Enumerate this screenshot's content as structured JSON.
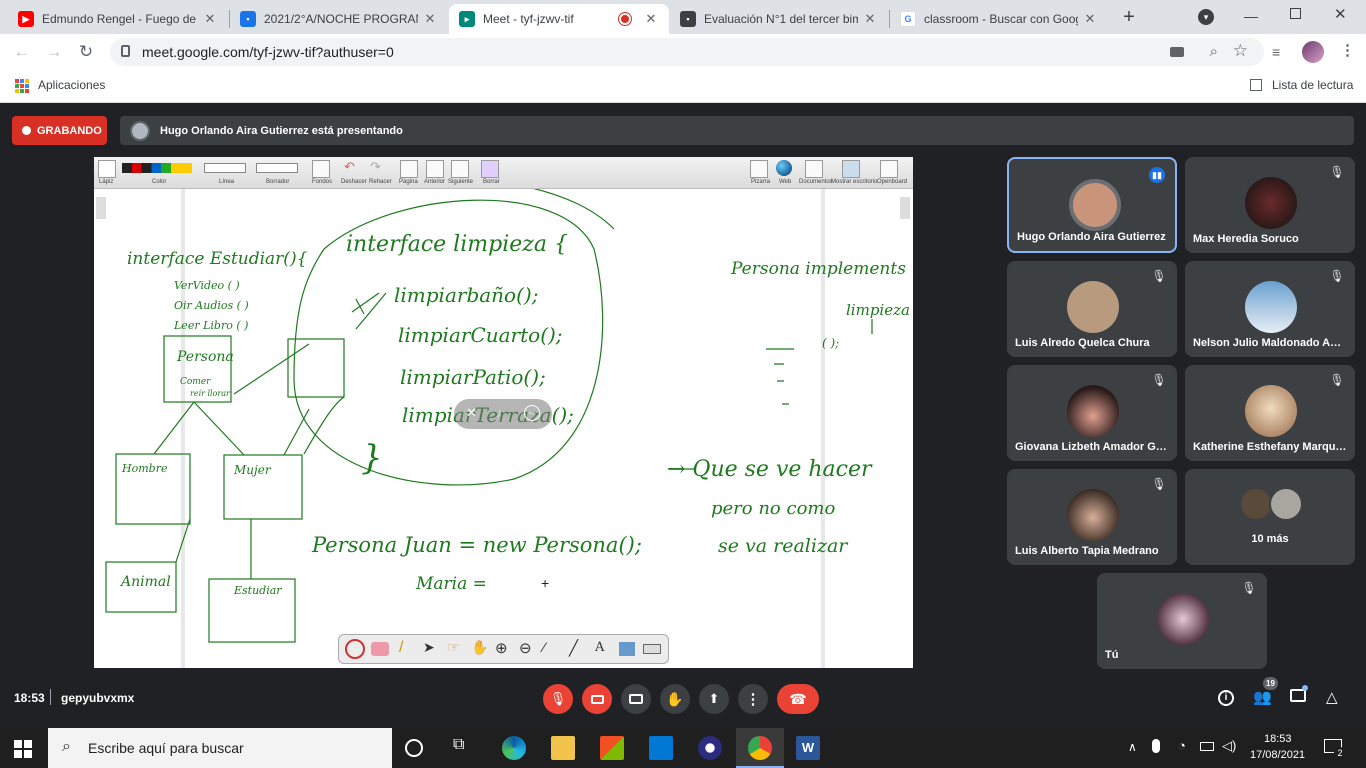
{
  "browser": {
    "tabs": [
      {
        "title": "Edmundo Rengel - Fuego de",
        "icon": "youtube-icon"
      },
      {
        "title": "2021/2°A/NOCHE PROGRAM",
        "icon": "classroom-icon"
      },
      {
        "title": "Meet - tyf-jzwv-tif",
        "icon": "meet-icon",
        "active": true
      },
      {
        "title": "Evaluación N°1 del tercer bim",
        "icon": "classroom-icon"
      },
      {
        "title": "classroom - Buscar con Goog",
        "icon": "google-icon"
      }
    ],
    "url": "meet.google.com/tyf-jzwv-tif?authuser=0",
    "apps_label": "Aplicaciones",
    "reading_list_label": "Lista de lectura"
  },
  "meet": {
    "recording_label": "GRABANDO",
    "presenting_text": "Hugo Orlando Aira Gutierrez está presentando",
    "whiteboard": {
      "toolbar_labels": [
        "Lápiz",
        "Color",
        "Línea",
        "Borrador",
        "Fondos",
        "Deshacer",
        "Rehacer",
        "Página",
        "Anterior",
        "Siguiente",
        "Borrar",
        "Pizarra",
        "Web",
        "Documentos",
        "Mostrar escritorio",
        "Openboard"
      ],
      "text": {
        "interface_estudiar": "interface Estudiar(){",
        "ver_video": "VerVideo ( )",
        "oir_audio": "Oir Audios ( )",
        "leer_libro": "Leer Libro ( )",
        "persona_box": "Persona",
        "persona_sub1": "Comer",
        "persona_sub2": "reír  llorar",
        "hombre": "Hombre",
        "mujer": "Mujer",
        "animal": "Animal",
        "estudiar": "Estudiar",
        "interface_limpieza": "interface limpieza {",
        "m1": "limpiarbaño();",
        "m2": "limpiarCuarto();",
        "m3": "limpiarPatio();",
        "m4": "limpiarTerraza();",
        "close_brace": "}",
        "persona_impl": "Persona implements",
        "limpieza": "limpieza",
        "semis": "( );",
        "que_se": "→ Que se ve hacer",
        "pero": "pero no como",
        "se_va": "se va realizar",
        "persona_juan": "Persona Juan = new Persona();",
        "maria": "Maria ="
      }
    },
    "participants": [
      {
        "name": "Hugo Orlando Aira Gutierrez",
        "speaking": true,
        "face": "#c9957a"
      },
      {
        "name": "Max Heredia Soruco",
        "muted": true,
        "face": "#2a1a1a"
      },
      {
        "name": "Luis Alredo Quelca Chura",
        "muted": true,
        "face": "#b89a7e"
      },
      {
        "name": "Nelson Julio Maldonado Am...",
        "muted": true,
        "face": "#8fb4d6"
      },
      {
        "name": "Giovana Lizbeth Amador Ga...",
        "muted": true,
        "face": "#6a3d2e"
      },
      {
        "name": "Katherine Esthefany Marque...",
        "muted": true,
        "face": "#d9c4a8"
      },
      {
        "name": "Luis Alberto Tapia Medrano",
        "muted": true,
        "face": "#a87c64"
      },
      {
        "name": "10 más",
        "face": "#7a6a5a"
      },
      {
        "name": "Tú",
        "muted": true,
        "face": "#c8a8b8"
      }
    ],
    "time": "18:53",
    "meeting_code": "gepyubvxmx",
    "participant_count": "19"
  },
  "taskbar": {
    "search_placeholder": "Escribe aquí para buscar",
    "time": "18:53",
    "date": "17/08/2021",
    "notifications": "2"
  },
  "colors": {
    "meet_bg": "#202124",
    "record_red": "#d93025",
    "speaking_blue": "#8ab4f8",
    "ink_green": "#1e7a1e"
  }
}
